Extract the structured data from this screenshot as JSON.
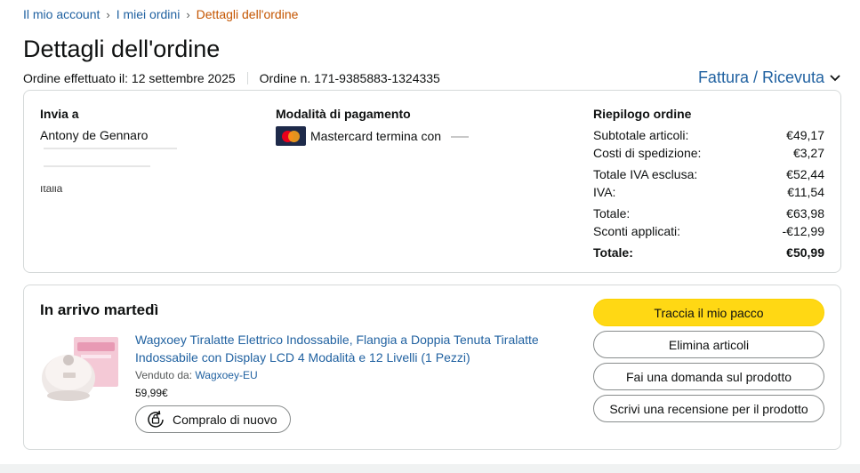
{
  "breadcrumb": {
    "items": [
      "Il mio account",
      "I miei ordini"
    ],
    "current": "Dettagli dell'ordine",
    "separator": "›"
  },
  "page_title": "Dettagli dell'ordine",
  "order_meta": {
    "placed": "Ordine effettuato il: 12 settembre 2025",
    "number": "Ordine n. 171-9385883-1324335"
  },
  "invoice_link": "Fattura / Ricevuta",
  "shipping": {
    "heading": "Invia a",
    "name": "Antony de Gennaro",
    "country": "Italia"
  },
  "payment": {
    "heading": "Modalità di pagamento",
    "card_text": "Mastercard termina con",
    "card_icon": "mastercard-icon"
  },
  "summary": {
    "heading": "Riepilogo ordine",
    "rows": [
      {
        "label": "Subtotale articoli:",
        "value": "€49,17"
      },
      {
        "label": "Costi di spedizione:",
        "value": "€3,27"
      },
      {
        "label": "Totale IVA esclusa:",
        "value": "€52,44"
      },
      {
        "label": "IVA:",
        "value": "€11,54"
      },
      {
        "label": "Totale:",
        "value": "€63,98"
      },
      {
        "label": "Sconti applicati:",
        "value": "-€12,99"
      },
      {
        "label": "Totale:",
        "value": "€50,99"
      }
    ]
  },
  "shipment": {
    "arrival": "In arrivo martedì",
    "product_title": "Wagxoey Tiralatte Elettrico Indossabile, Flangia a Doppia Tenuta Tiralatte Indossabile con Display LCD 4 Modalità e 12 Livelli (1 Pezzi)",
    "sold_by_label": "Venduto da:",
    "seller": "Wagxoey-EU",
    "price": "59,99€",
    "buy_again": "Compralo di nuovo"
  },
  "actions": {
    "track": "Traccia il mio pacco",
    "remove": "Elimina articoli",
    "question": "Fai una domanda sul prodotto",
    "review": "Scrivi una recensione per il prodotto"
  },
  "colors": {
    "link": "#2162a1",
    "breadcrumb_current": "#c45500",
    "primary_button": "#ffd814",
    "border": "#d5d9d9"
  }
}
